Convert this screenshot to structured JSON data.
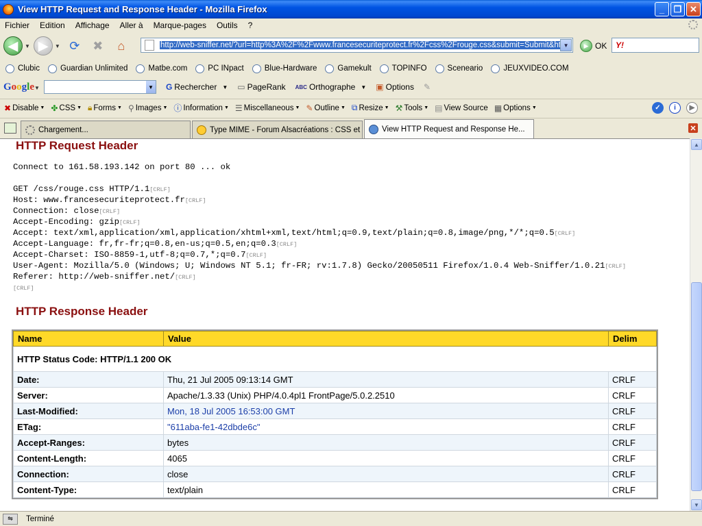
{
  "window": {
    "title": "View HTTP Request and Response Header - Mozilla Firefox"
  },
  "menu": [
    "Fichier",
    "Edition",
    "Affichage",
    "Aller à",
    "Marque-pages",
    "Outils",
    "?"
  ],
  "nav": {
    "url": "http://web-sniffer.net/?url=http%3A%2F%2Fwww.francesecuriteprotect.fr%2Fcss%2Frouge.css&submit=Submit&http",
    "go_label": "OK"
  },
  "bookmarks": [
    "Clubic",
    "Guardian Unlimited",
    "Matbe.com",
    "PC INpact",
    "Blue-Hardware",
    "Gamekult",
    "TOPINFO",
    "Sceneario",
    "JEUXVIDEO.COM"
  ],
  "googlebar": {
    "search": "Rechercher",
    "pagerank": "PageRank",
    "spell": "Orthographe",
    "options": "Options"
  },
  "devbar": [
    "Disable",
    "CSS",
    "Forms",
    "Images",
    "Information",
    "Miscellaneous",
    "Outline",
    "Resize",
    "Tools",
    "View Source",
    "Options"
  ],
  "tabs": [
    {
      "label": "Chargement..."
    },
    {
      "label": "Type MIME - Forum Alsacréations : CSS et S..."
    },
    {
      "label": "View HTTP Request and Response He..."
    }
  ],
  "request": {
    "title": "HTTP Request Header",
    "connect": "Connect to 161.58.193.142 on port 80 ... ok",
    "crlf": "[CRLF]",
    "lines": [
      "GET /css/rouge.css HTTP/1.1",
      "Host: www.francesecuriteprotect.fr",
      "Connection: close",
      "Accept-Encoding: gzip",
      "Accept: text/xml,application/xml,application/xhtml+xml,text/html;q=0.9,text/plain;q=0.8,image/png,*/*;q=0.5",
      "Accept-Language: fr,fr-fr;q=0.8,en-us;q=0.5,en;q=0.3",
      "Accept-Charset: ISO-8859-1,utf-8;q=0.7,*;q=0.7",
      "User-Agent: Mozilla/5.0 (Windows; U; Windows NT 5.1; fr-FR; rv:1.7.8) Gecko/20050511 Firefox/1.0.4 Web-Sniffer/1.0.21",
      "Referer: http://web-sniffer.net/"
    ]
  },
  "response": {
    "title": "HTTP Response Header",
    "headers": [
      "Name",
      "Value",
      "Delim"
    ],
    "status": "HTTP Status Code: HTTP/1.1 200 OK",
    "rows": [
      {
        "name": "Date:",
        "value": "Thu, 21 Jul 2005 09:13:14 GMT",
        "delim": "CRLF"
      },
      {
        "name": "Server:",
        "value": "Apache/1.3.33 (Unix) PHP/4.0.4pl1 FrontPage/5.0.2.2510",
        "delim": "CRLF"
      },
      {
        "name": "Last-Modified:",
        "value": "Mon, 18 Jul 2005 16:53:00 GMT",
        "delim": "CRLF"
      },
      {
        "name": "ETag:",
        "value": "\"611aba-fe1-42dbde6c\"",
        "delim": "CRLF"
      },
      {
        "name": "Accept-Ranges:",
        "value": "bytes",
        "delim": "CRLF"
      },
      {
        "name": "Content-Length:",
        "value": "4065",
        "delim": "CRLF"
      },
      {
        "name": "Connection:",
        "value": "close",
        "delim": "CRLF"
      },
      {
        "name": "Content-Type:",
        "value": "text/plain",
        "delim": "CRLF"
      }
    ]
  },
  "status": {
    "text": "Terminé"
  }
}
